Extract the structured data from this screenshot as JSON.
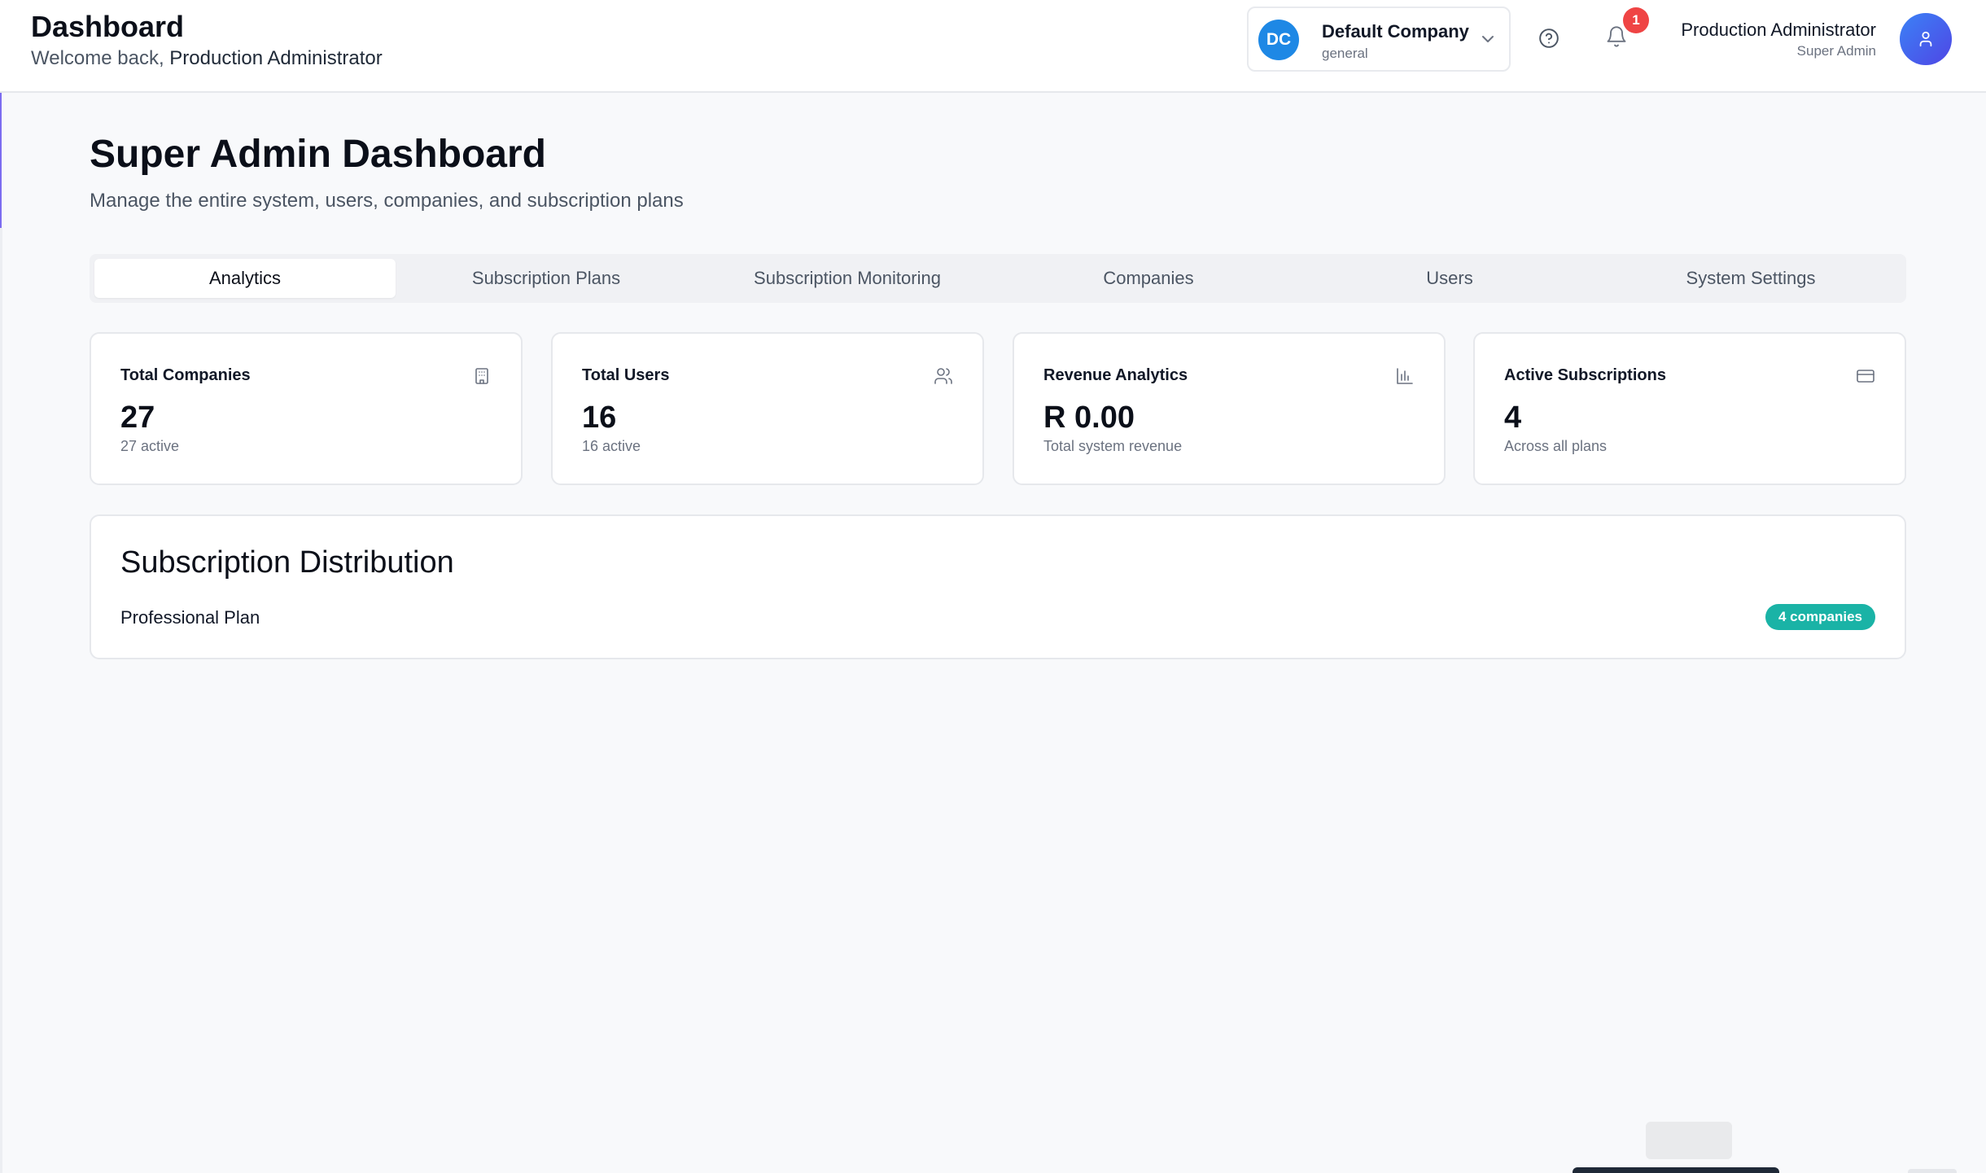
{
  "header": {
    "title": "Dashboard",
    "welcome_prefix": "Welcome back, ",
    "welcome_name": "Production Administrator",
    "company": {
      "initials": "DC",
      "name": "Default Company",
      "type": "general"
    },
    "notifications_count": "1",
    "user": {
      "name": "Production Administrator",
      "role": "Super Admin"
    }
  },
  "main": {
    "title": "Super Admin Dashboard",
    "subtitle": "Manage the entire system, users, companies, and subscription plans",
    "tabs": [
      {
        "label": "Analytics",
        "active": true
      },
      {
        "label": "Subscription Plans"
      },
      {
        "label": "Subscription Monitoring"
      },
      {
        "label": "Companies"
      },
      {
        "label": "Users"
      },
      {
        "label": "System Settings"
      }
    ],
    "stats": [
      {
        "title": "Total Companies",
        "value": "27",
        "sub": "27 active",
        "icon": "building-icon"
      },
      {
        "title": "Total Users",
        "value": "16",
        "sub": "16 active",
        "icon": "users-icon"
      },
      {
        "title": "Revenue Analytics",
        "value": "R 0.00",
        "sub": "Total system revenue",
        "icon": "bar-chart-icon"
      },
      {
        "title": "Active Subscriptions",
        "value": "4",
        "sub": "Across all plans",
        "icon": "credit-card-icon"
      }
    ],
    "distribution": {
      "title": "Subscription Distribution",
      "plan": "Professional Plan",
      "badge": "4 companies"
    }
  },
  "colors": {
    "accent": "#1e88e5",
    "badge_teal": "#1ab3a6",
    "notification_red": "#ef4444",
    "avatar_gradient_start": "#3b82f6",
    "avatar_gradient_end": "#4f46e5"
  }
}
